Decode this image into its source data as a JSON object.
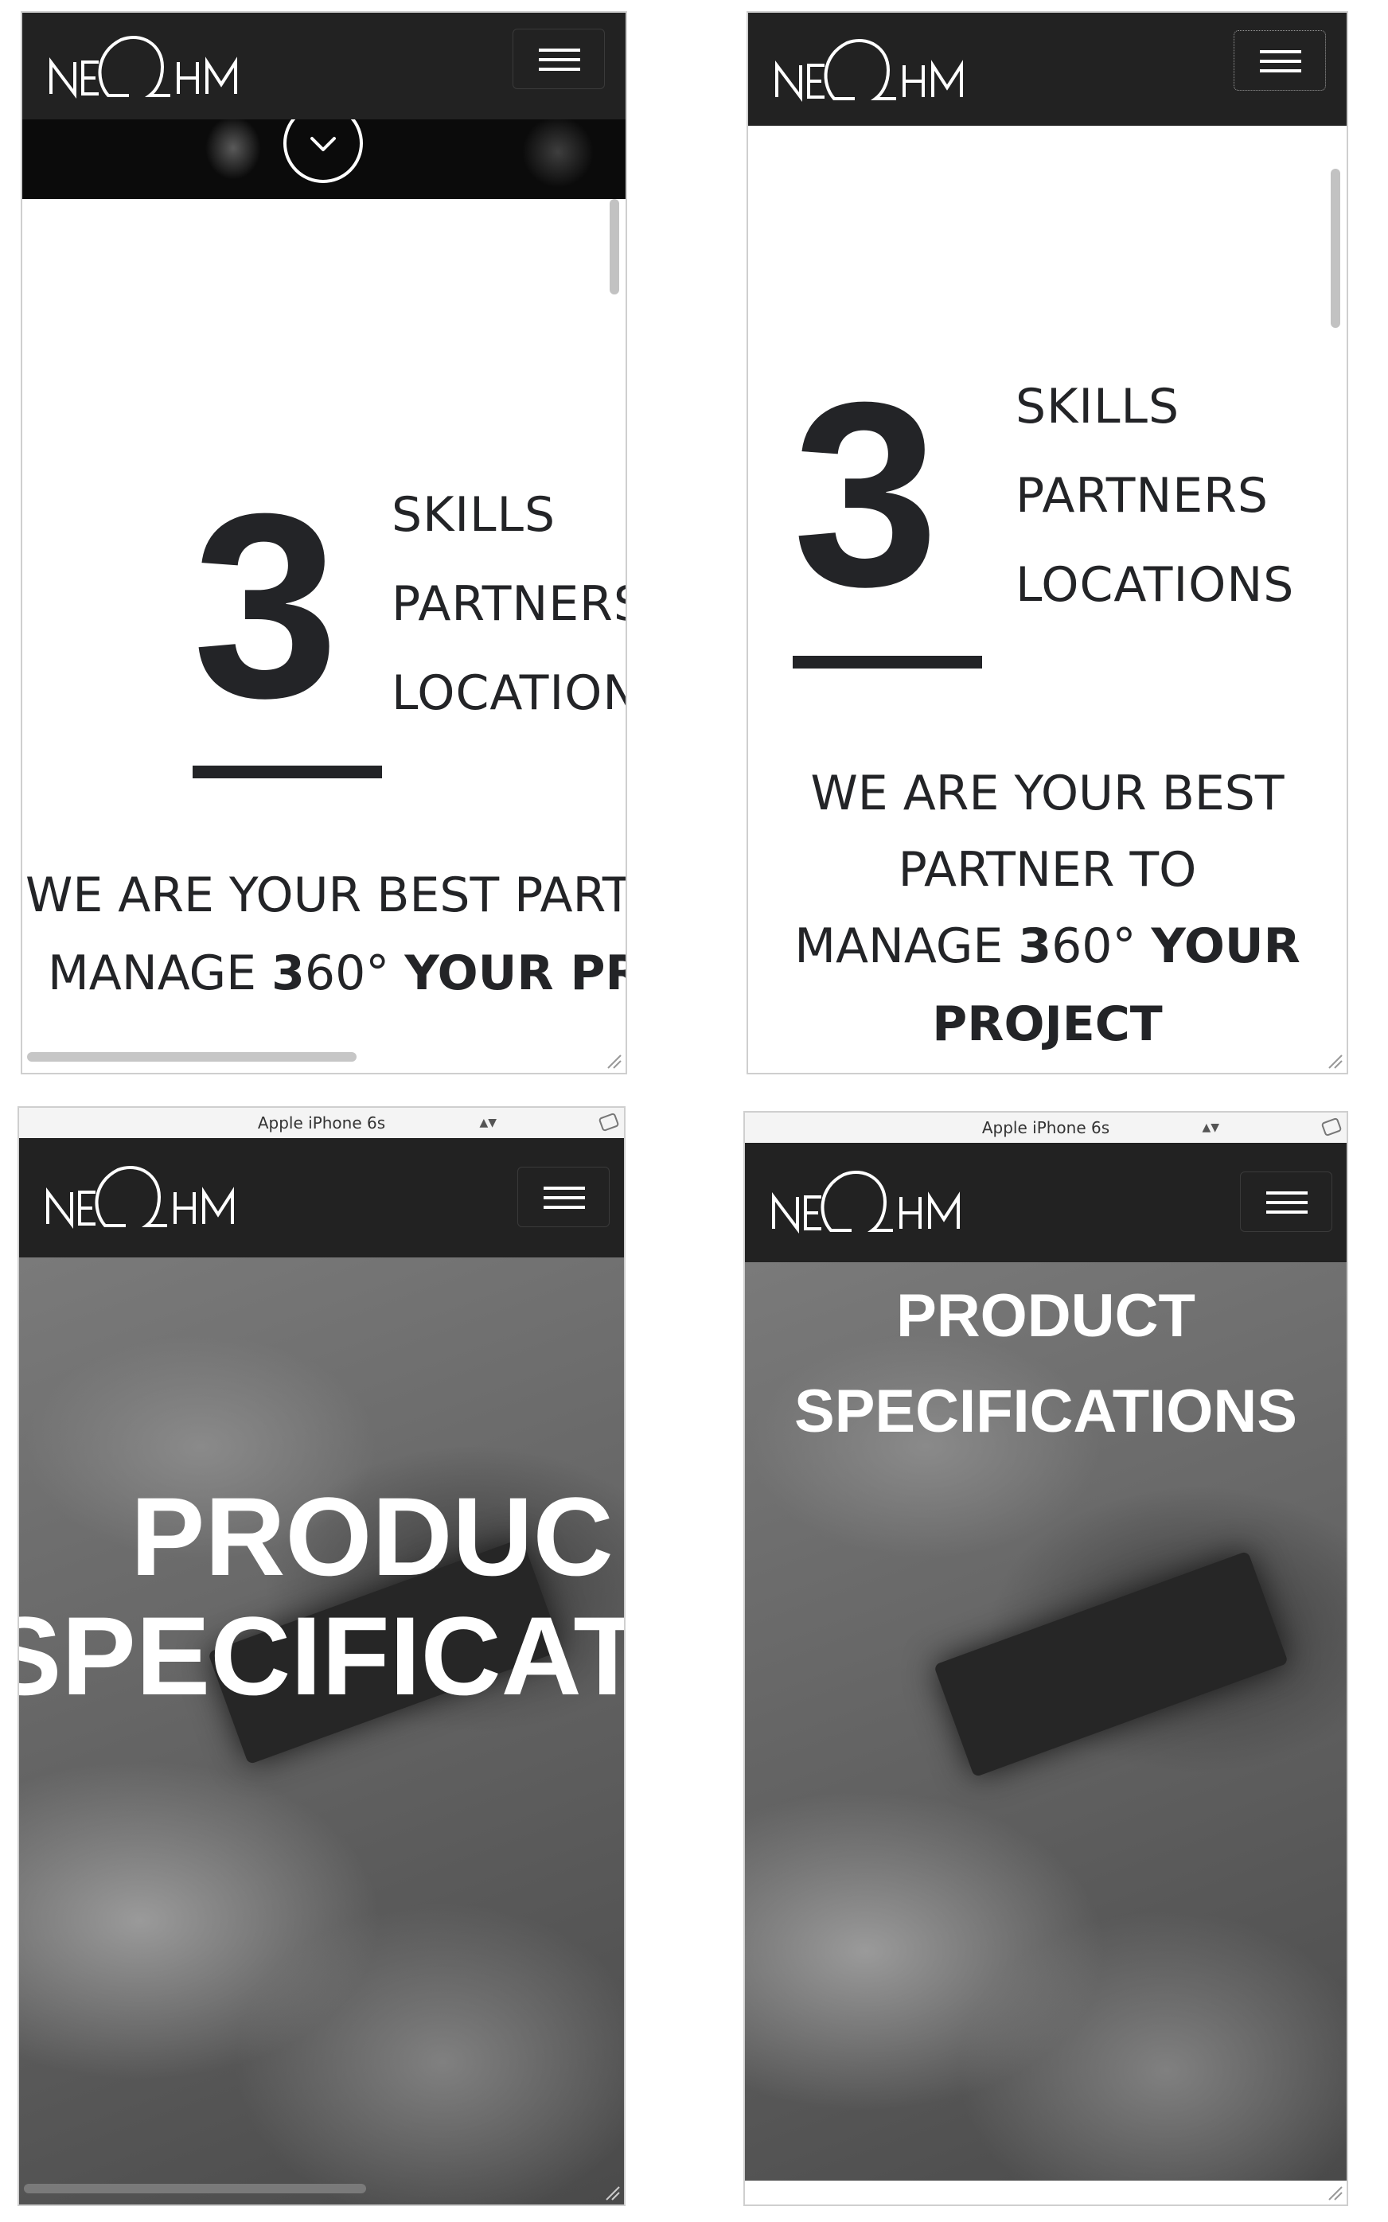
{
  "brand": {
    "logo_text": "NEOHM"
  },
  "menu": {
    "icon": "hamburger-menu-icon"
  },
  "device": {
    "name": "Apple iPhone 6s"
  },
  "stats": {
    "number": "3",
    "labels": [
      "SKILLS",
      "PARTNERS",
      "LOCATIONS"
    ]
  },
  "tagline": {
    "cropped_line1": "WE ARE YOUR BEST PART",
    "cropped_line2_a": "MANAGE ",
    "cropped_line2_b": "3",
    "cropped_line2_c": "60° ",
    "cropped_line2_d": "YOUR PR",
    "full_line1": "WE ARE YOUR BEST",
    "full_line2": "PARTNER TO",
    "full_line3_a": "MANAGE ",
    "full_line3_b": "3",
    "full_line3_c": "60° ",
    "full_line3_d": "YOUR",
    "full_line4": "PROJECT"
  },
  "hero": {
    "cropped_line1": "PRODUC",
    "cropped_line2": "SPECIFICAT",
    "full_line1": "PRODUCT",
    "full_line2": "SPECIFICATIONS"
  },
  "colors": {
    "navbar": "#222222",
    "text": "#232427",
    "white": "#ffffff"
  }
}
